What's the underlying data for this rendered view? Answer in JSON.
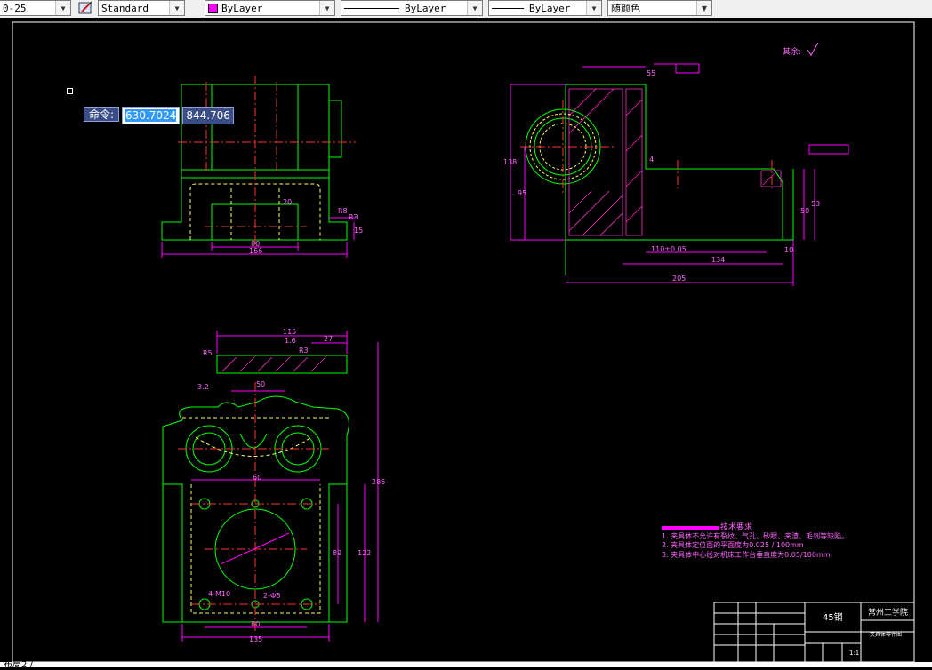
{
  "toolbar": {
    "dimstyle_value": "0-25",
    "textstyle_value": "Standard",
    "layer_color_value": "ByLayer",
    "linetype_value": "ByLayer",
    "lineweight_value": "ByLayer",
    "plotstyle_value": "随颜色"
  },
  "command": {
    "label": "命令:",
    "x_value": "630.7024",
    "y_value": "844.706"
  },
  "status": {
    "text": "布局2 /"
  },
  "drawing": {
    "roughness_note": "其余:",
    "tech_title": "技术要求",
    "tech_items": [
      "1. 夹具体不允许有裂纹、气孔、砂眼、夹渣、毛刺等缺陷。",
      "2. 夹具体定位面的平面度为0.025 / 100mm",
      "3. 夹具体中心线对机床工作台垂直度为0.05/100mm"
    ],
    "title_block": {
      "material": "45钢",
      "school": "常州工学院",
      "part_name": "夹具体零件图",
      "scale": "1:1"
    },
    "dims_front": [
      "80",
      "166",
      "R3",
      "15",
      "R8",
      "20"
    ],
    "dims_side": [
      "138",
      "95",
      "50",
      "53",
      "110±0.05",
      "134",
      "205",
      "10",
      "55",
      "4"
    ],
    "dims_bottom": [
      "115",
      "27",
      "1.6",
      "3.2",
      "R3",
      "50",
      "60",
      "80",
      "135",
      "122",
      "89",
      "4-M10",
      "2-Φ8",
      "286",
      "R5"
    ]
  }
}
